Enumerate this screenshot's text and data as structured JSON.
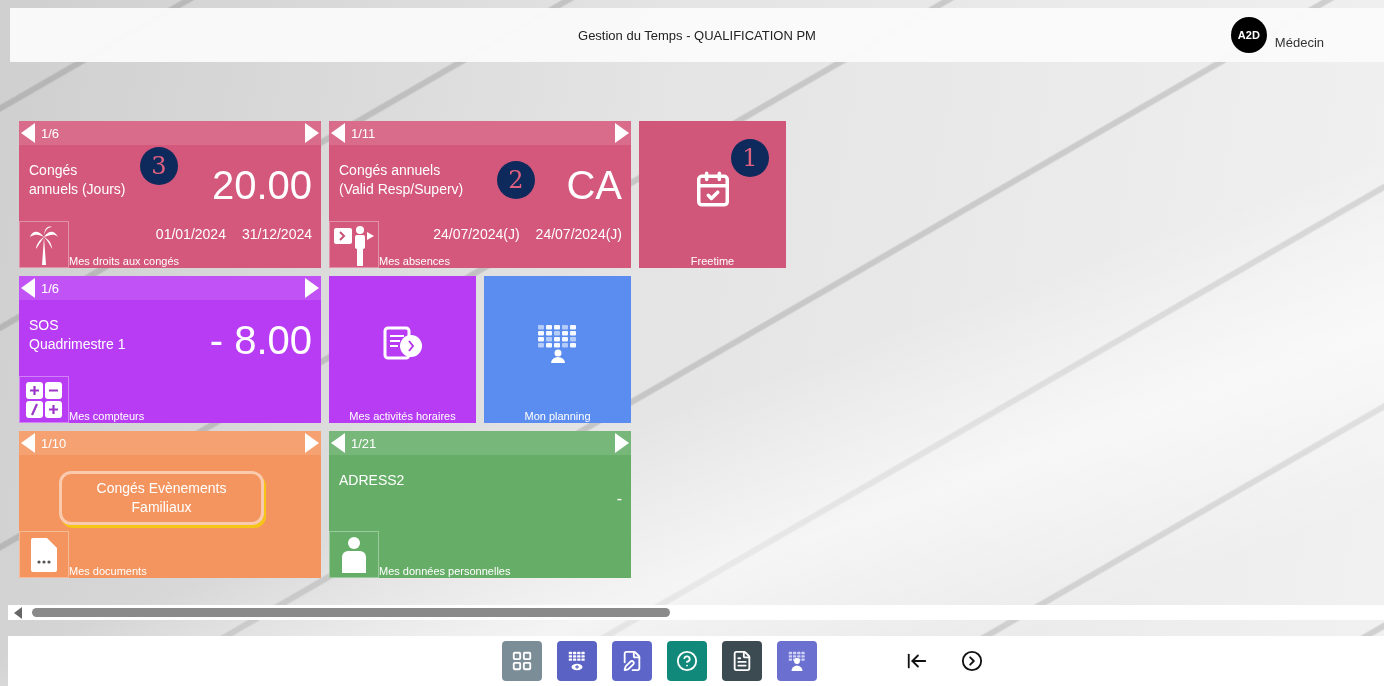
{
  "header": {
    "title": "Gestion du Temps - QUALIFICATION PM",
    "avatar": "A2D",
    "role": "Médecin"
  },
  "tile_rows": [
    [
      {
        "kind": "carousel",
        "color": "#d4577c",
        "pager": "1/6",
        "title": [
          "Congés",
          "annuels (Jours)"
        ],
        "value": "20.00",
        "dates": [
          "01/01/2024",
          "31/12/2024"
        ],
        "caption": "Mes droits aux congés",
        "badge": "3"
      },
      {
        "kind": "carousel",
        "color": "#d4577c",
        "pager": "1/11",
        "title": [
          "Congés annuels",
          "(Valid Resp/Superv)"
        ],
        "value": "CA",
        "dates": [
          "24/07/2024(J)",
          "24/07/2024(J)"
        ],
        "caption": "Mes absences",
        "badge": "2"
      },
      {
        "kind": "shortcut",
        "color": "#d0567a",
        "caption": "Freetime",
        "badge": "1"
      }
    ],
    [
      {
        "kind": "carousel",
        "color": "#b93cf5",
        "pager": "1/6",
        "title": [
          "SOS",
          "Quadrimestre 1"
        ],
        "value": "- 8.00",
        "caption": "Mes compteurs"
      },
      {
        "kind": "shortcut",
        "color": "#b93cf5",
        "caption": "Mes activités horaires"
      },
      {
        "kind": "shortcut",
        "color": "#5b8cf0",
        "caption": "Mon planning"
      }
    ],
    [
      {
        "kind": "carousel",
        "color": "#f4955f",
        "pager": "1/10",
        "action": "Congés Evènements Familiaux",
        "caption": "Mes documents"
      },
      {
        "kind": "carousel",
        "color": "#66ae68",
        "pager": "1/21",
        "title": [
          "ADRESS2"
        ],
        "value": "-",
        "caption": "Mes données personnelles"
      }
    ]
  ],
  "toolbar": {
    "buttons": [
      {
        "color": "#7b8d96"
      },
      {
        "color": "#5a62c4"
      },
      {
        "color": "#5d66c8"
      },
      {
        "color": "#11897a"
      },
      {
        "color": "#3c4a52"
      },
      {
        "color": "#6a6fd0"
      }
    ]
  }
}
